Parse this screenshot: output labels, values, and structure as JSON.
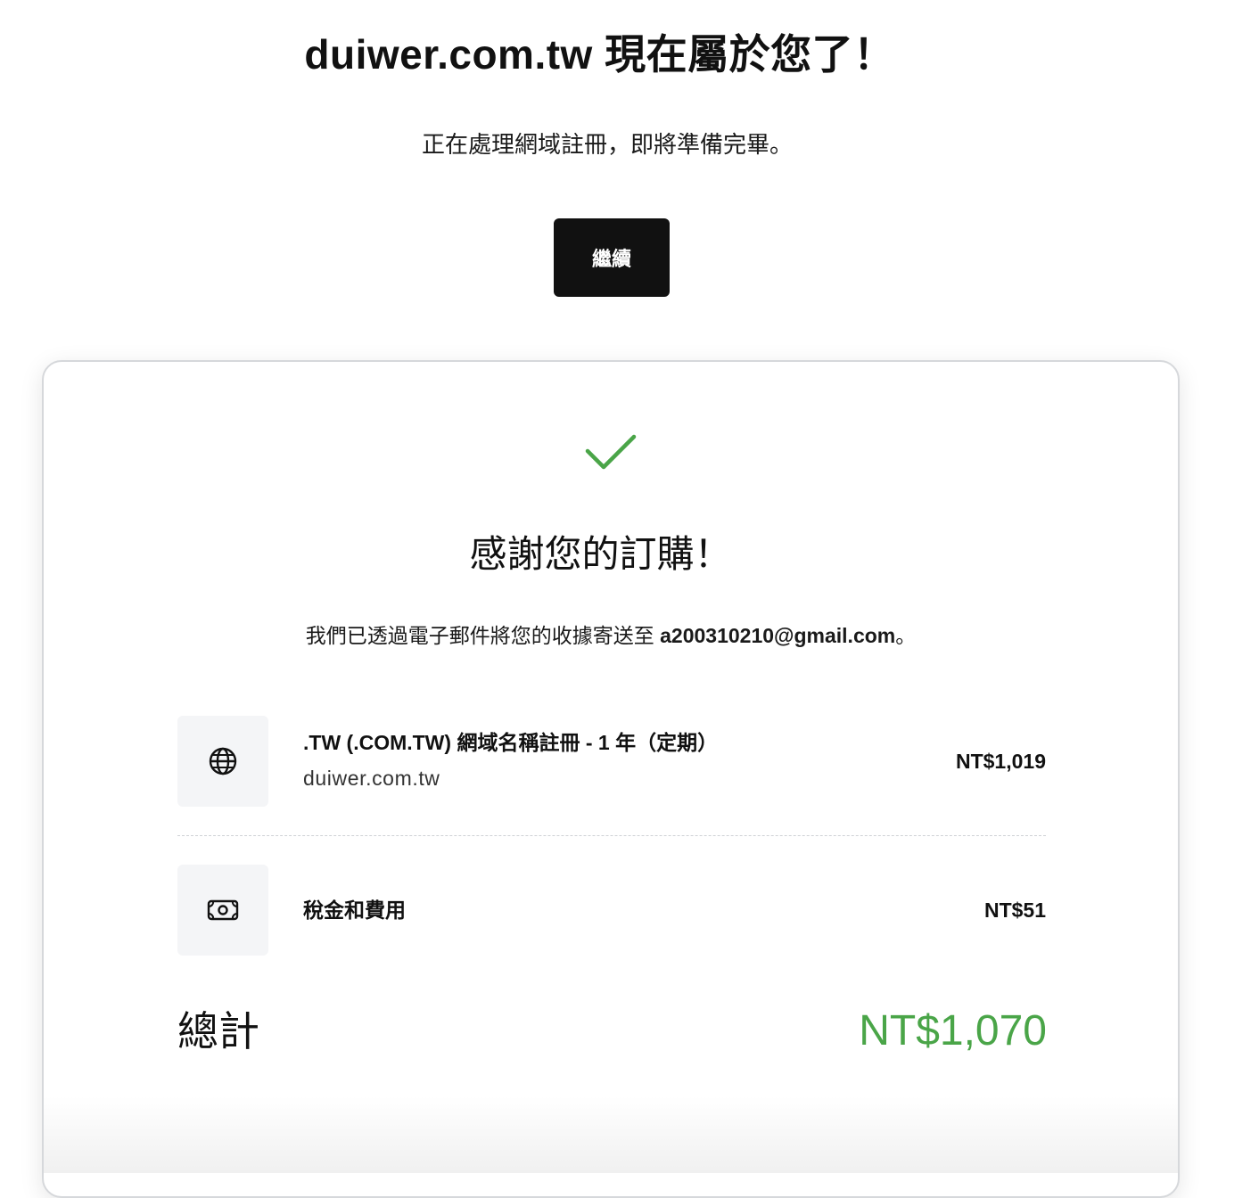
{
  "header": {
    "title": "duiwer.com.tw 現在屬於您了！",
    "subtitle": "正在處理網域註冊，即將準備完畢。",
    "continue_label": "繼續"
  },
  "confirmation": {
    "check_icon": "checkmark-icon",
    "heading": "感謝您的訂購！",
    "receipt_prefix": "我們已透過電子郵件將您的收據寄送至 ",
    "receipt_email": "a200310210@gmail.com",
    "receipt_suffix": "。"
  },
  "line_items": [
    {
      "icon": "globe-icon",
      "title": ".TW (.COM.TW) 網域名稱註冊 - 1 年（定期）",
      "subtitle": "duiwer.com.tw",
      "price": "NT$1,019"
    },
    {
      "icon": "money-icon",
      "title": "稅金和費用",
      "price": "NT$51"
    }
  ],
  "total": {
    "label": "總計",
    "amount": "NT$1,070"
  },
  "colors": {
    "accent_green": "#4aa548",
    "button_bg": "#111111",
    "icon_box_bg": "#f4f5f7",
    "card_border": "#d6d8db"
  }
}
